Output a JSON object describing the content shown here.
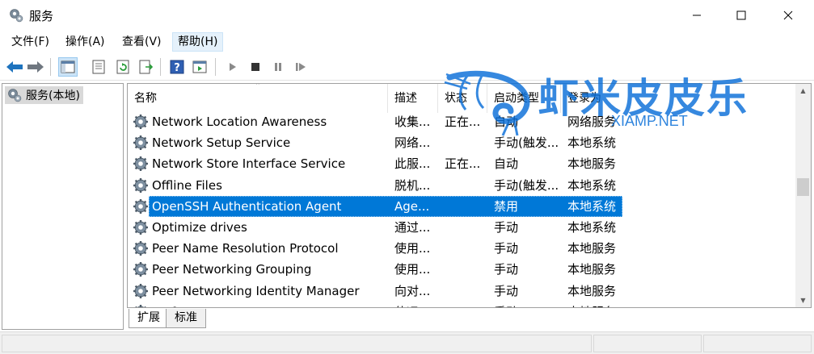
{
  "window": {
    "title": "服务"
  },
  "menu": [
    {
      "label": "文件(F)"
    },
    {
      "label": "操作(A)"
    },
    {
      "label": "查看(V)"
    },
    {
      "label": "帮助(H)"
    }
  ],
  "toolbar": {
    "icons": [
      "back-arrow-icon",
      "forward-arrow-icon",
      "show-tree-icon",
      "properties-icon",
      "refresh-icon",
      "export-list-icon",
      "help-icon",
      "action-pane-icon",
      "start-service-icon",
      "stop-service-icon",
      "pause-service-icon",
      "restart-service-icon"
    ]
  },
  "tree": {
    "root_label": "服务(本地)"
  },
  "list": {
    "columns": [
      "名称",
      "描述",
      "状态",
      "启动类型",
      "登录为"
    ],
    "rows": [
      {
        "name": "Network Location Awareness",
        "desc": "收集...",
        "status": "正在...",
        "startup": "自动",
        "logon": "网络服务"
      },
      {
        "name": "Network Setup Service",
        "desc": "网络...",
        "status": "",
        "startup": "手动(触发...",
        "logon": "本地系统"
      },
      {
        "name": "Network Store Interface Service",
        "desc": "此服...",
        "status": "正在...",
        "startup": "自动",
        "logon": "本地服务"
      },
      {
        "name": "Offline Files",
        "desc": "脱机...",
        "status": "",
        "startup": "手动(触发...",
        "logon": "本地系统"
      },
      {
        "name": "OpenSSH Authentication Agent",
        "desc": "Age...",
        "status": "",
        "startup": "禁用",
        "logon": "本地系统"
      },
      {
        "name": "Optimize drives",
        "desc": "通过...",
        "status": "",
        "startup": "手动",
        "logon": "本地系统"
      },
      {
        "name": "Peer Name Resolution Protocol",
        "desc": "使用...",
        "status": "",
        "startup": "手动",
        "logon": "本地服务"
      },
      {
        "name": "Peer Networking Grouping",
        "desc": "使用...",
        "status": "",
        "startup": "手动",
        "logon": "本地服务"
      },
      {
        "name": "Peer Networking Identity Manager",
        "desc": "向对...",
        "status": "",
        "startup": "手动",
        "logon": "本地服务"
      },
      {
        "name": "Performance Counter DLL Host",
        "desc": "使远...",
        "status": "",
        "startup": "手动",
        "logon": "本地服务"
      }
    ],
    "selected_index": 4
  },
  "tabs": [
    {
      "label": "扩展"
    },
    {
      "label": "标准"
    }
  ],
  "watermark": {
    "text": "虾米皮皮乐",
    "sub": "XIAMP.NET"
  },
  "colors": {
    "selection": "#0078d7",
    "watermark": "#0a6fd8",
    "toolbar_blue": "#1e73be"
  }
}
